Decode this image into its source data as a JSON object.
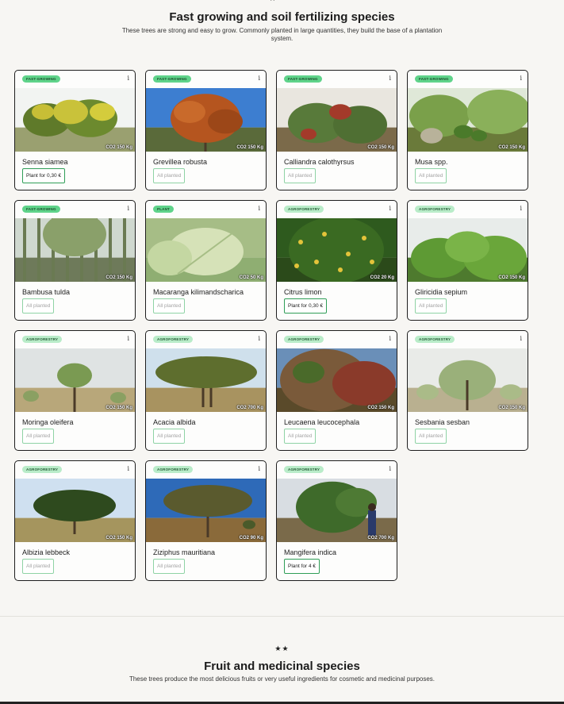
{
  "section1": {
    "title": "Fast growing and soil fertilizing species",
    "subtitle": "These trees are strong and easy to grow. Commonly planted in large quantities, they build the base of a plantation system."
  },
  "info_glyph": "i",
  "cards": [
    {
      "badge": "FAST-GROWING",
      "name": "Senna siamea",
      "co2": "CO2 150 Kg",
      "button": "Plant for 0,30 €",
      "active": true,
      "photo_kind": "yellow-tree"
    },
    {
      "badge": "FAST-GROWING",
      "name": "Grevillea robusta",
      "co2": "CO2 150 Kg",
      "button": "All planted",
      "active": false,
      "photo_kind": "orange-tree"
    },
    {
      "badge": "FAST-GROWING",
      "name": "Calliandra calothyrsus",
      "co2": "CO2 150 Kg",
      "button": "All planted",
      "active": false,
      "photo_kind": "shrub-red"
    },
    {
      "badge": "FAST-GROWING",
      "name": "Musa spp.",
      "co2": "CO2 150 Kg",
      "button": "All planted",
      "active": false,
      "photo_kind": "banana"
    },
    {
      "badge": "FAST-GROWING",
      "name": "Bambusa tulda",
      "co2": "CO2 150 Kg",
      "button": "All planted",
      "active": false,
      "photo_kind": "bamboo"
    },
    {
      "badge": "PLANT",
      "name": "Macaranga kilimandscharica",
      "co2": "CO2 50 Kg",
      "button": "All planted",
      "active": false,
      "photo_kind": "leaf"
    },
    {
      "badge": "AGROFORESTRY",
      "name": "Citrus limon",
      "co2": "CO2 20 Kg",
      "button": "Plant for 0,30 €",
      "active": true,
      "photo_kind": "citrus"
    },
    {
      "badge": "AGROFORESTRY",
      "name": "Gliricidia sepium",
      "co2": "CO2 150 Kg",
      "button": "All planted",
      "active": false,
      "photo_kind": "bush"
    },
    {
      "badge": "AGROFORESTRY",
      "name": "Moringa oleifera",
      "co2": "CO2 150 Kg",
      "button": "All planted",
      "active": false,
      "photo_kind": "savanna"
    },
    {
      "badge": "AGROFORESTRY",
      "name": "Acacia albida",
      "co2": "CO2 700 Kg",
      "button": "All planted",
      "active": false,
      "photo_kind": "acacia"
    },
    {
      "badge": "AGROFORESTRY",
      "name": "Leucaena leucocephala",
      "co2": "CO2 150 Kg",
      "button": "All planted",
      "active": false,
      "photo_kind": "dense-red"
    },
    {
      "badge": "AGROFORESTRY",
      "name": "Sesbania sesban",
      "co2": "CO2 150 Kg",
      "button": "All planted",
      "active": false,
      "photo_kind": "sparse"
    },
    {
      "badge": "AGROFORESTRY",
      "name": "Albizia lebbeck",
      "co2": "CO2 150 Kg",
      "button": "All planted",
      "active": false,
      "photo_kind": "umbrella"
    },
    {
      "badge": "AGROFORESTRY",
      "name": "Ziziphus mauritiana",
      "co2": "CO2 90 Kg",
      "button": "All planted",
      "active": false,
      "photo_kind": "lone-tree"
    },
    {
      "badge": "AGROFORESTRY",
      "name": "Mangifera indica",
      "co2": "CO2 700 Kg",
      "button": "Plant for 4 €",
      "active": true,
      "photo_kind": "mango"
    }
  ],
  "section2": {
    "stars": "★★",
    "title": "Fruit and medicinal species",
    "subtitle": "These trees produce the most delicious fruits or very useful ingredients for cosmetic and medicinal purposes."
  },
  "colors": {
    "badge_dark": "#5fd38a",
    "badge_light": "#b9ecc9",
    "active_border": "#2f9e57",
    "disabled_border": "#8fd3a5"
  }
}
